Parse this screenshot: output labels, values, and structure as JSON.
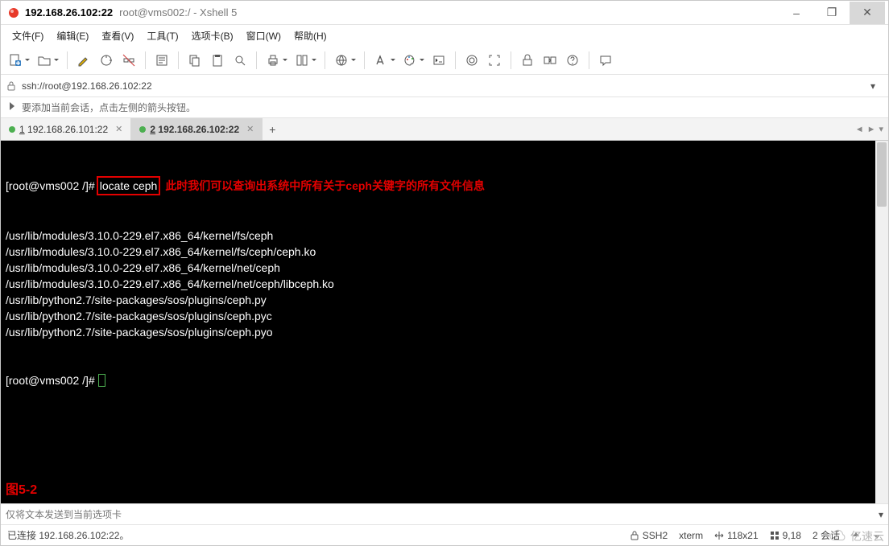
{
  "title": {
    "main": "192.168.26.102:22",
    "sub": "root@vms002:/ - Xshell 5"
  },
  "window_controls": {
    "min": "–",
    "max": "❐",
    "close": "✕"
  },
  "menus": [
    "文件(F)",
    "编辑(E)",
    "查看(V)",
    "工具(T)",
    "选项卡(B)",
    "窗口(W)",
    "帮助(H)"
  ],
  "toolbar_icons": [
    "new-file-icon",
    "open-folder-icon",
    "pencil-icon",
    "reconnect-icon",
    "disconnect-icon",
    "properties-icon",
    "copy-icon",
    "paste-icon",
    "search-icon",
    "print-icon",
    "columns-icon",
    "globe-icon",
    "font-icon",
    "palette-icon",
    "terminal-icon",
    "script-icon",
    "fullscreen-icon",
    "lock-icon",
    "transfer-icon",
    "help-icon",
    "comment-icon"
  ],
  "toolbar_has_dropdown": {
    "new-file-icon": true,
    "open-folder-icon": true,
    "print-icon": true,
    "columns-icon": true,
    "globe-icon": true,
    "font-icon": true,
    "palette-icon": true
  },
  "address": {
    "url": "ssh://root@192.168.26.102:22"
  },
  "infobar": {
    "text": "要添加当前会话，点击左侧的箭头按钮。"
  },
  "tabs": [
    {
      "num": "1",
      "label": "192.168.26.101:22",
      "active": false
    },
    {
      "num": "2",
      "label": "192.168.26.102:22",
      "active": true
    }
  ],
  "tab_add": "+",
  "terminal": {
    "prompt1": "[root@vms002 /]#",
    "command": "locate ceph",
    "annotation": "此时我们可以查询出系统中所有关于ceph关键字的所有文件信息",
    "lines": [
      "/usr/lib/modules/3.10.0-229.el7.x86_64/kernel/fs/ceph",
      "/usr/lib/modules/3.10.0-229.el7.x86_64/kernel/fs/ceph/ceph.ko",
      "/usr/lib/modules/3.10.0-229.el7.x86_64/kernel/net/ceph",
      "/usr/lib/modules/3.10.0-229.el7.x86_64/kernel/net/ceph/libceph.ko",
      "/usr/lib/python2.7/site-packages/sos/plugins/ceph.py",
      "/usr/lib/python2.7/site-packages/sos/plugins/ceph.pyc",
      "/usr/lib/python2.7/site-packages/sos/plugins/ceph.pyo"
    ],
    "prompt2": "[root@vms002 /]# ",
    "figlabel": "图5-2"
  },
  "sendbar": {
    "placeholder": "仅将文本发送到当前选项卡"
  },
  "status": {
    "connection": "已连接 192.168.26.102:22。",
    "protocol": "SSH2",
    "termtype": "xterm",
    "size": "118x21",
    "cursor": "9,18",
    "sessions": "2 会话"
  },
  "watermark": "亿速云"
}
